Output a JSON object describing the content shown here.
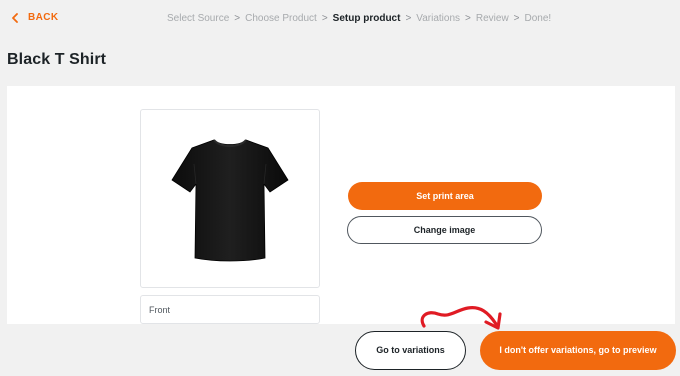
{
  "header": {
    "back_label": "BACK",
    "steps": [
      {
        "label": "Select Source",
        "active": false
      },
      {
        "label": "Choose Product",
        "active": false
      },
      {
        "label": "Setup product",
        "active": true
      },
      {
        "label": "Variations",
        "active": false
      },
      {
        "label": "Review",
        "active": false
      },
      {
        "label": "Done!",
        "active": false
      }
    ],
    "separator": ">"
  },
  "product": {
    "title": "Black T Shirt",
    "image_icon": "tshirt-image",
    "image_label": "Front"
  },
  "actions": {
    "set_print_area": "Set print area",
    "change_image": "Change image"
  },
  "footer": {
    "go_to_variations": "Go to variations",
    "skip_variations": "I don't offer variations, go to preview"
  },
  "colors": {
    "accent": "#f26a0f",
    "annotation_arrow": "#e01b24",
    "background": "#f1f1f1",
    "panel": "#ffffff",
    "text": "#1d2327"
  }
}
